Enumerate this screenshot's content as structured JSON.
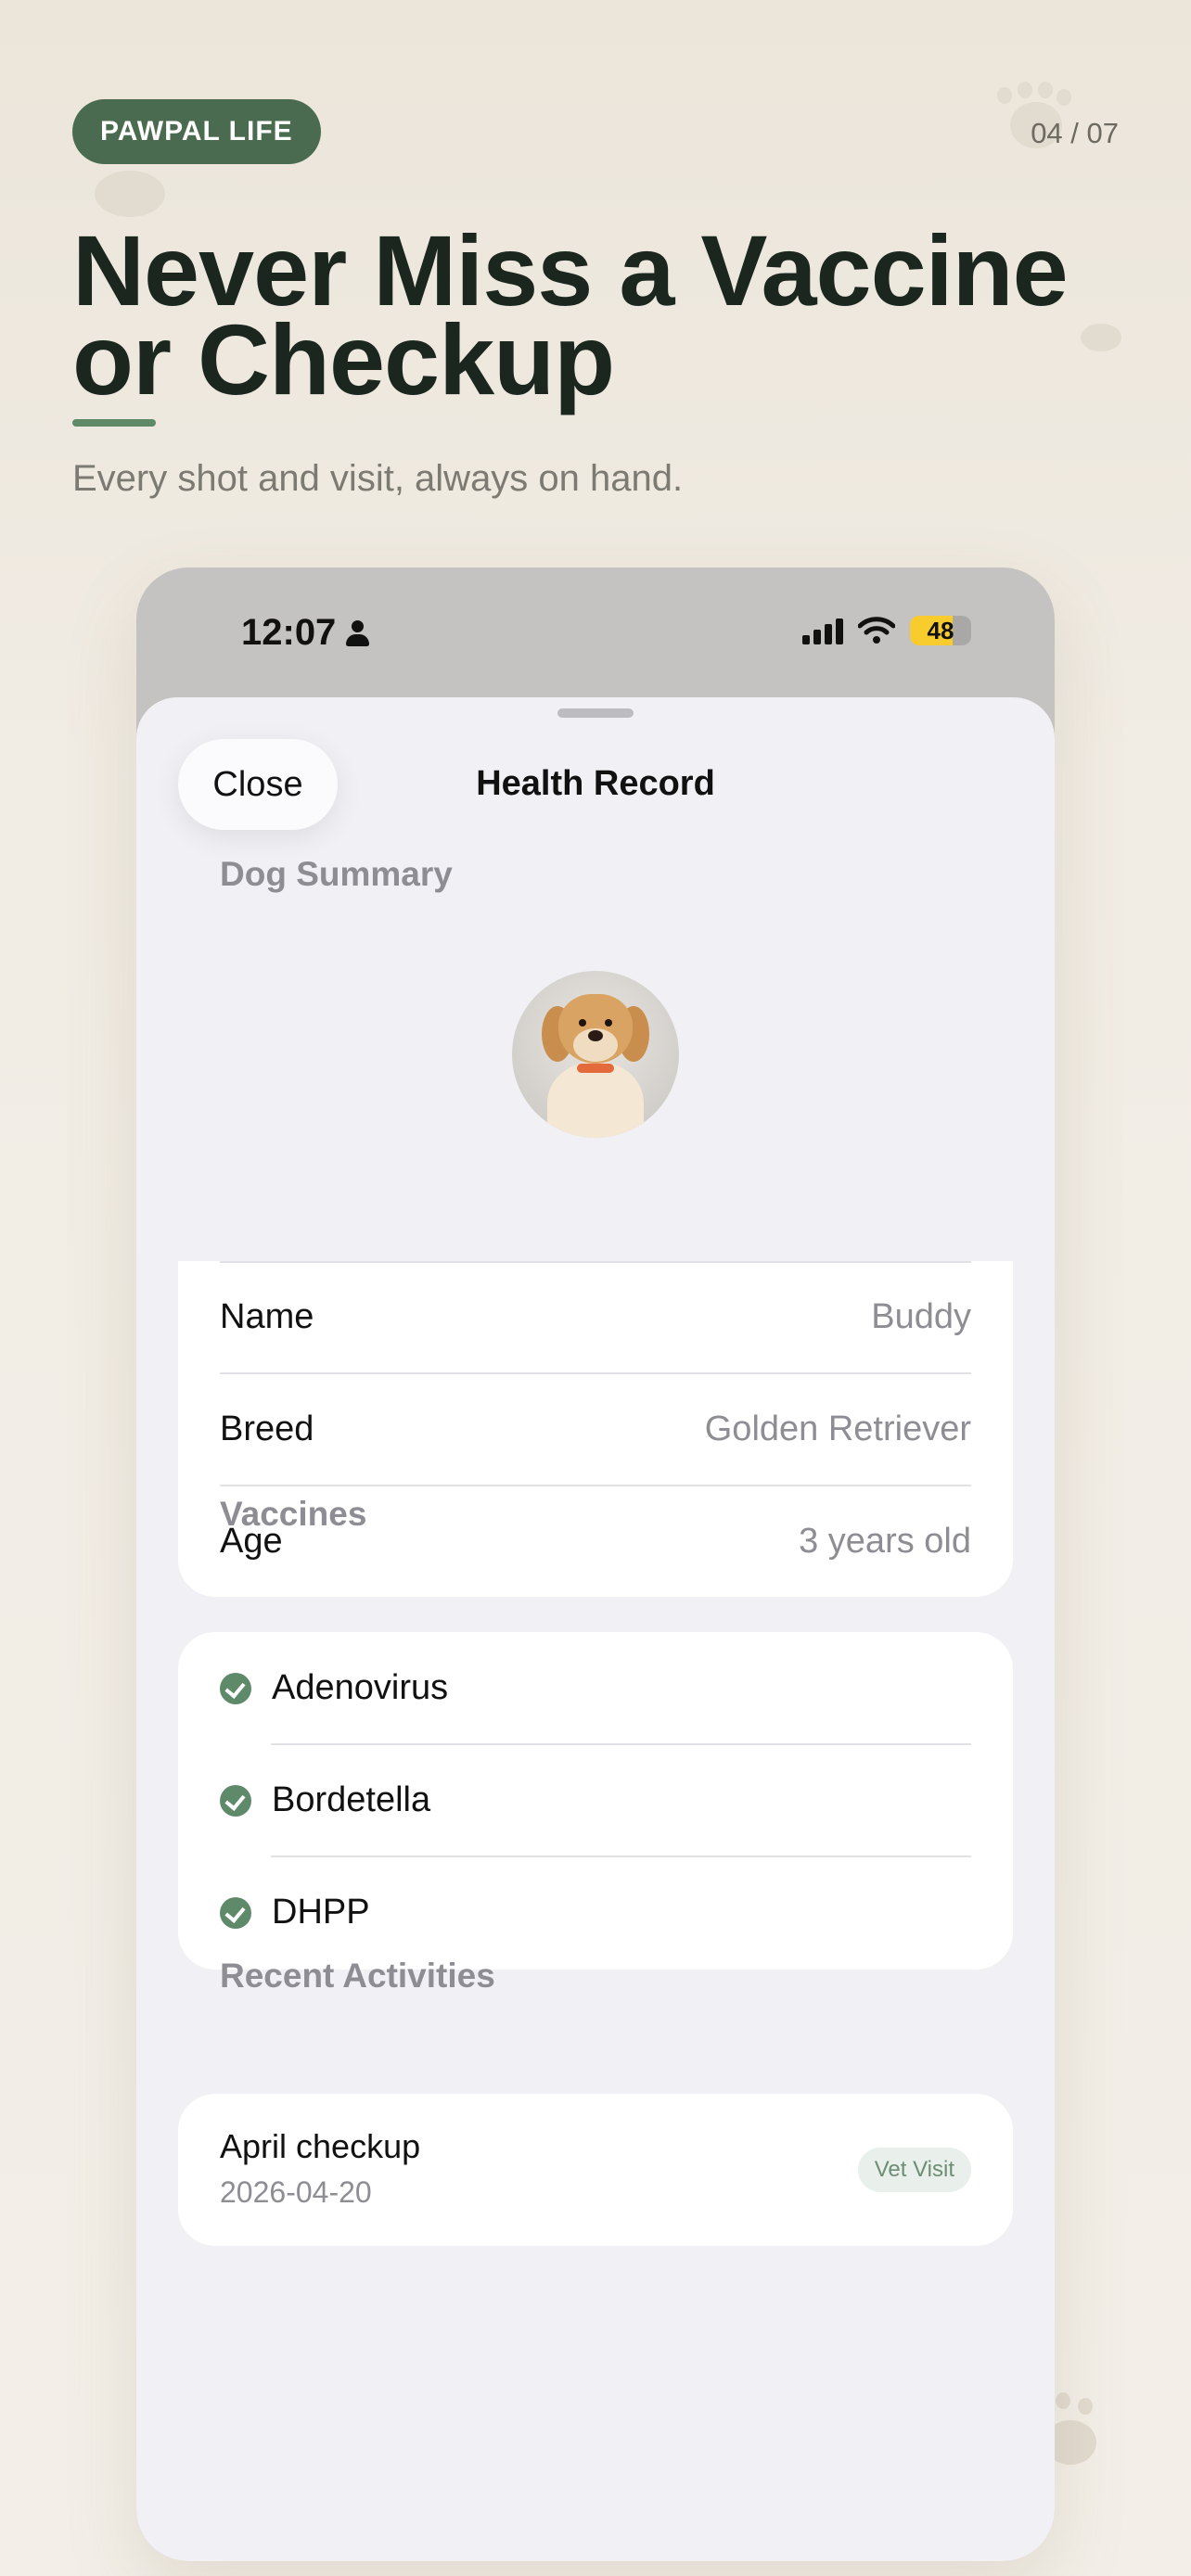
{
  "promo": {
    "brand": "PAWPAL LIFE",
    "page_counter": "04 / 07",
    "headline": "Never Miss a Vaccine or Checkup",
    "subtitle": "Every shot and visit, always on hand."
  },
  "status_bar": {
    "time": "12:07",
    "battery": "48"
  },
  "sheet": {
    "close_label": "Close",
    "title": "Health Record",
    "dog_summary_header": "Dog Summary",
    "fields": [
      {
        "label": "Name",
        "value": "Buddy"
      },
      {
        "label": "Breed",
        "value": "Golden Retriever"
      },
      {
        "label": "Age",
        "value": "3 years old"
      }
    ],
    "vaccines_header": "Vaccines",
    "vaccines": [
      "Adenovirus",
      "Bordetella",
      "DHPP"
    ],
    "activities_header": "Recent Activities",
    "activities": [
      {
        "title": "April checkup",
        "date": "2026-04-20",
        "tag": "Vet Visit"
      }
    ]
  },
  "colors": {
    "brand_green": "#4a6b4f",
    "check_green": "#5e8a6a",
    "background": "#f1ece4"
  }
}
